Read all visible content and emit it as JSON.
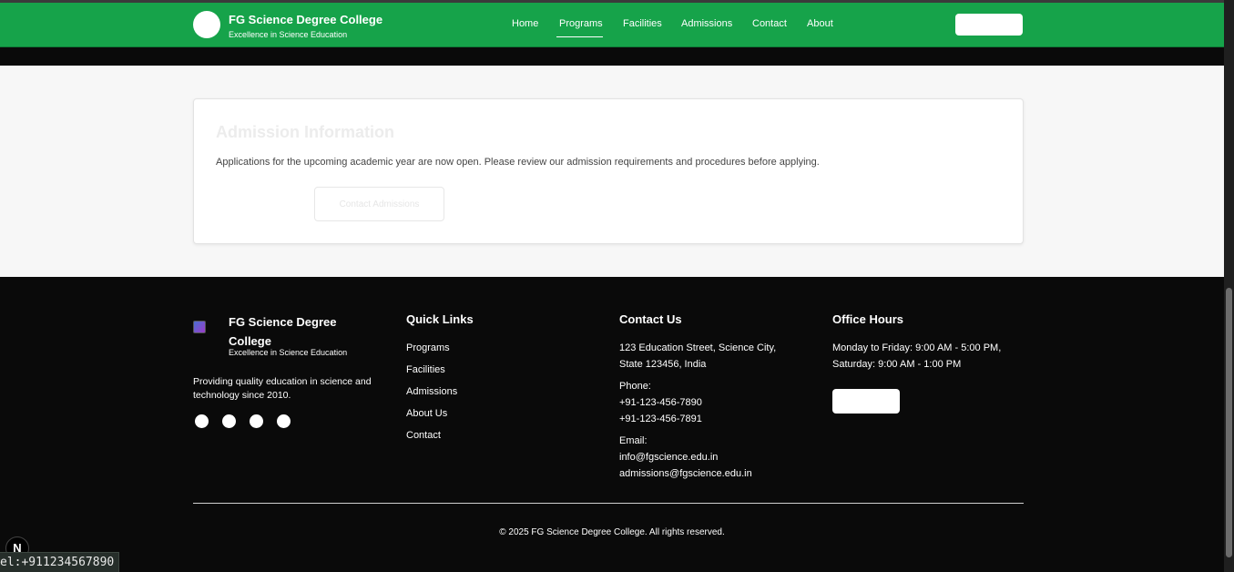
{
  "header": {
    "title": "FG Science Degree College",
    "subtitle": "Excellence in Science Education",
    "nav": [
      "Home",
      "Programs",
      "Facilities",
      "Admissions",
      "Contact",
      "About"
    ],
    "active_nav": "Programs"
  },
  "admission_card": {
    "title": "Admission Information",
    "text": "Applications for the upcoming academic year are now open. Please review our admission requirements and procedures before applying.",
    "button_label": "Contact Admissions"
  },
  "footer": {
    "brand_title": "FG Science Degree College",
    "brand_subtitle": "Excellence in Science Education",
    "description": "Providing quality education in science and technology since 2010.",
    "quick_links": {
      "heading": "Quick Links",
      "items": [
        "Programs",
        "Facilities",
        "Admissions",
        "About Us",
        "Contact"
      ]
    },
    "contact": {
      "heading": "Contact Us",
      "address_line1": "123 Education Street, Science City,",
      "address_line2": "State 123456, India",
      "phone_label": "Phone:",
      "phone1": "+91-123-456-7890",
      "phone2": "+91-123-456-7891",
      "email_label": "Email:",
      "email1": "info@fgscience.edu.in",
      "email2": "admissions@fgscience.edu.in"
    },
    "hours": {
      "heading": "Office Hours",
      "line1": "Monday to Friday: 9:00 AM - 5:00 PM,",
      "line2": "Saturday: 9:00 AM - 1:00 PM"
    },
    "copyright": "© 2025 FG Science Degree College. All rights reserved."
  },
  "overlay": {
    "badge": "N",
    "status_url": "el:+911234567890"
  },
  "colors": {
    "brand_green": "#16a34a",
    "footer_bg": "#0a0a0a"
  }
}
